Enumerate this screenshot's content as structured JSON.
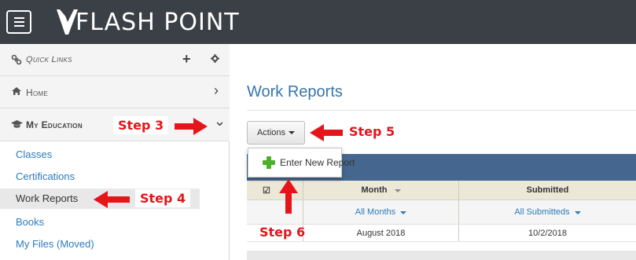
{
  "header": {
    "menu_icon": "hamburger-icon",
    "logo_text": "FLASH POINT",
    "bg_color": "#3b3f46"
  },
  "sidebar": {
    "quick_links": {
      "label": "Quick Links",
      "icon": "link-icon",
      "add_icon": "plus-icon",
      "settings_icon": "gear-icon"
    },
    "home": {
      "label": "Home",
      "icon": "home-icon",
      "chevron": "chevron-right-icon",
      "chevron_glyph": "›"
    },
    "my_education": {
      "label": "My Education",
      "icon": "graduation-cap-icon",
      "chevron": "chevron-down-icon",
      "chevron_glyph": "⌄"
    },
    "links": [
      {
        "label": "Classes"
      },
      {
        "label": "Certifications"
      },
      {
        "label": "Work Reports",
        "active": true
      },
      {
        "label": "Books"
      },
      {
        "label": "My Files (Moved)"
      }
    ]
  },
  "main": {
    "page_title": "Work Reports",
    "actions_button": "Actions",
    "dropdown": {
      "items": [
        {
          "label": "Enter New Report",
          "icon": "add-icon"
        }
      ]
    },
    "table": {
      "columns": [
        {
          "label": "",
          "icon": "check-icon",
          "glyph": "☑"
        },
        {
          "label": "Month"
        },
        {
          "label": "Submitted"
        }
      ],
      "filters": [
        "",
        "All Months",
        "All Submitteds"
      ],
      "rows": [
        [
          "",
          "August 2018",
          "10/2/2018"
        ]
      ]
    }
  },
  "annotations": {
    "step3": "Step 3",
    "step4": "Step 4",
    "step5": "Step 5",
    "step6": "Step 6",
    "color": "#e5151a"
  }
}
